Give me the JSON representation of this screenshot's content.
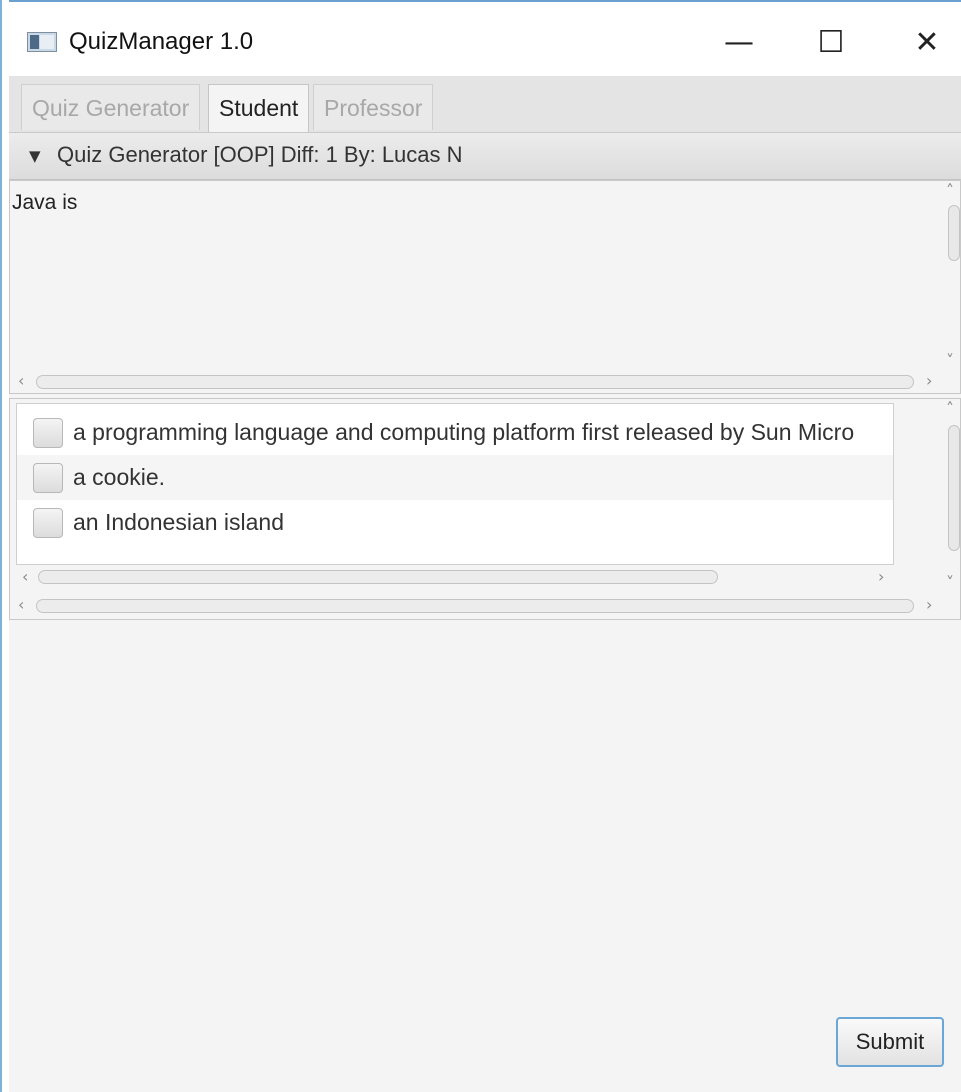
{
  "window": {
    "title": "QuizManager 1.0",
    "minimize_glyph": "—",
    "maximize_glyph": "☐",
    "close_glyph": "✕"
  },
  "tabs": [
    {
      "label": "Quiz Generator",
      "active": false
    },
    {
      "label": "Student",
      "active": true
    },
    {
      "label": "Professor",
      "active": false
    }
  ],
  "quiz_pane": {
    "collapse_glyph": "▼",
    "title": "Quiz Generator  [OOP] Diff: 1 By: Lucas N"
  },
  "question": {
    "text": "Java is"
  },
  "answers": [
    {
      "label": "a programming language and computing platform first released by Sun Micro",
      "checked": false
    },
    {
      "label": "a cookie.",
      "checked": false
    },
    {
      "label": "an Indonesian island",
      "checked": false
    }
  ],
  "actions": {
    "submit_label": "Submit"
  },
  "colors": {
    "accent": "#6aa6d6",
    "background": "#f4f4f4",
    "tab_inactive_text": "#a8a8a8"
  }
}
